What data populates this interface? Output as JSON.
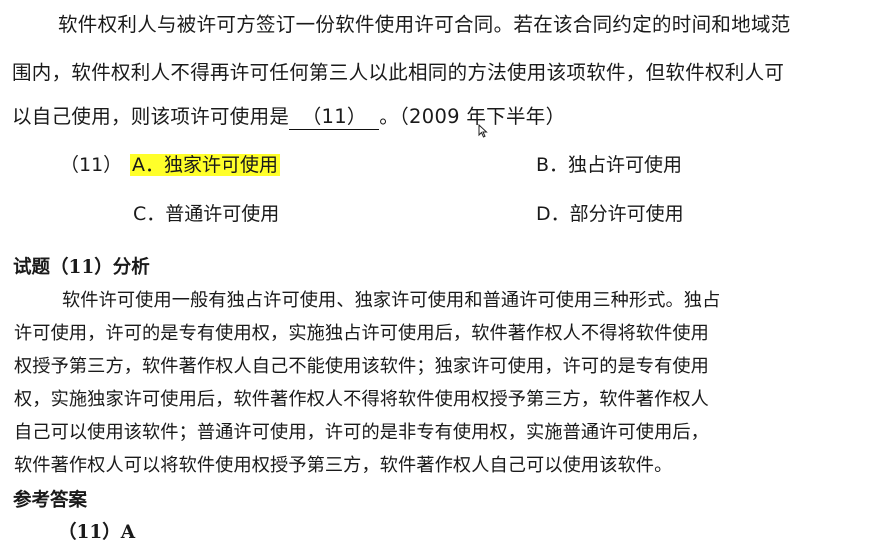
{
  "question": {
    "line1": "软件权利人与被许可方签订一份软件使用许可合同。若在该合同约定的时间和地域范",
    "line2": "围内，软件权利人不得再许可任何第三人以此相同的方法使用该项软件，但软件权利人可",
    "line3_before": "以自己使用，则该项许可使用是",
    "blank": "（11）",
    "line3_after": "。（2009 年下半年）"
  },
  "options": {
    "number": "（11）",
    "a": "A．独家许可使用",
    "b": "B．独占许可使用",
    "c": "C．普通许可使用",
    "d": "D．部分许可使用",
    "highlight_color": "#ffff2a"
  },
  "analysis": {
    "heading": "试题（11）分析",
    "lines": [
      "软件许可使用一般有独占许可使用、独家许可使用和普通许可使用三种形式。独占",
      "许可使用，许可的是专有使用权，实施独占许可使用后，软件著作权人不得将软件使用",
      "权授予第三方，软件著作权人自己不能使用该软件；独家许可使用，许可的是专有使用",
      "权，实施独家许可使用后，软件著作权人不得将软件使用权授予第三方，软件著作权人",
      "自己可以使用该软件；普通许可使用，许可的是非专有使用权，实施普通许可使用后，",
      "软件著作权人可以将软件使用权授予第三方，软件著作权人自己可以使用该软件。"
    ]
  },
  "answer": {
    "heading": "参考答案",
    "value": "（11）A"
  }
}
